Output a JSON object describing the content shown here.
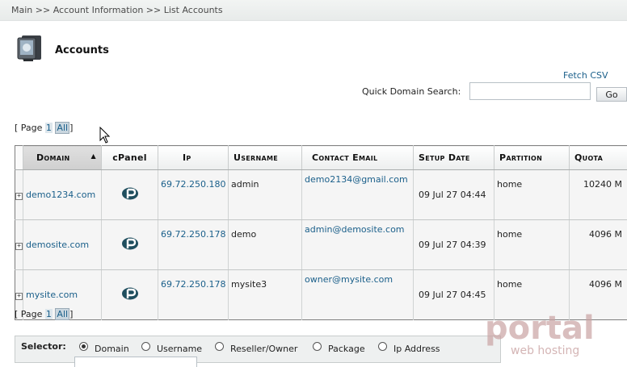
{
  "breadcrumb": [
    "Main",
    ">>",
    "Account Information",
    ">>",
    "List Accounts"
  ],
  "page_title": "Accounts",
  "fetch_csv": "Fetch CSV",
  "search": {
    "label": "Quick Domain Search:",
    "value": "",
    "go_label": "Go"
  },
  "pager": {
    "open": "[ Page",
    "page_num": "1",
    "all": "All",
    "close": "]"
  },
  "table": {
    "headers": {
      "domain": "Domain",
      "cpanel": "cPanel",
      "ip": "Ip",
      "username": "Username",
      "email": "Contact Email",
      "setup": "Setup Date",
      "partition": "Partition",
      "quota": "Quota"
    },
    "rows": [
      {
        "domain": "demo1234.com",
        "ip": "69.72.250.180",
        "username": "admin",
        "email": "demo2134@gmail.com",
        "setup": "09 Jul 27 04:44",
        "partition": "home",
        "quota": "10240 M"
      },
      {
        "domain": "demosite.com",
        "ip": "69.72.250.178",
        "username": "demo",
        "email": "admin@demosite.com",
        "setup": "09 Jul 27 04:39",
        "partition": "home",
        "quota": "4096 M"
      },
      {
        "domain": "mysite.com",
        "ip": "69.72.250.178",
        "username": "mysite3",
        "email": "owner@mysite.com",
        "setup": "09 Jul 27 04:45",
        "partition": "home",
        "quota": "4096 M"
      }
    ]
  },
  "selector": {
    "label": "Selector:",
    "options": [
      "Domain",
      "Username",
      "Reseller/Owner",
      "Package",
      "Ip Address"
    ],
    "selected": "Domain"
  },
  "watermark": {
    "brand": "portal",
    "sub": "web hosting"
  },
  "colors": {
    "link": "#1a5f8a",
    "watermark": "#c9a3a3"
  }
}
